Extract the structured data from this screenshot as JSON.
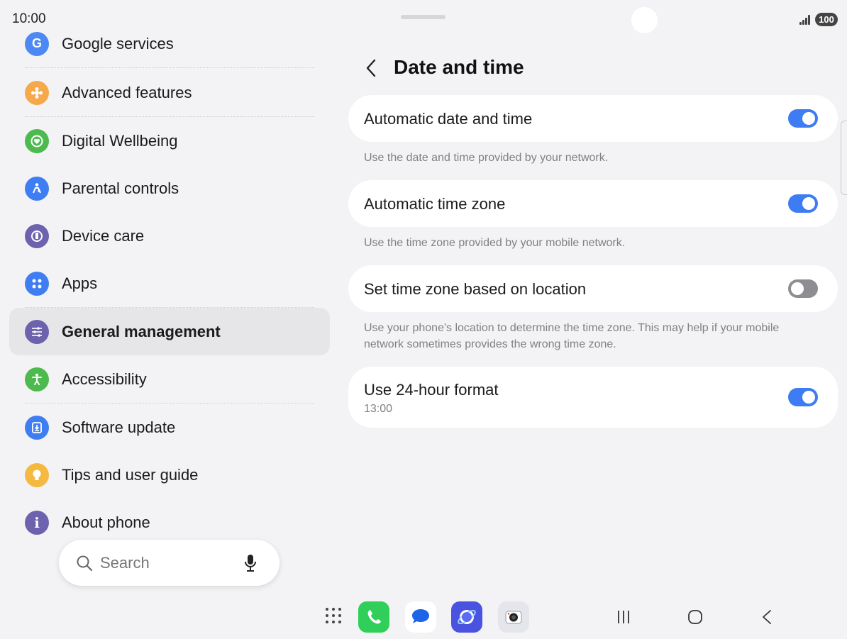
{
  "status_bar": {
    "time": "10:00",
    "battery": "100"
  },
  "sidebar": {
    "items": [
      {
        "label": "Google services"
      },
      {
        "label": "Advanced features"
      },
      {
        "label": "Digital Wellbeing"
      },
      {
        "label": "Parental controls"
      },
      {
        "label": "Device care"
      },
      {
        "label": "Apps"
      },
      {
        "label": "General management"
      },
      {
        "label": "Accessibility"
      },
      {
        "label": "Software update"
      },
      {
        "label": "Tips and user guide"
      },
      {
        "label": "About phone"
      }
    ],
    "selected": "General management"
  },
  "search": {
    "placeholder": "Search"
  },
  "page": {
    "title": "Date and time",
    "settings": [
      {
        "title": "Automatic date and time",
        "enabled": true,
        "description": "Use the date and time provided by your network."
      },
      {
        "title": "Automatic time zone",
        "enabled": true,
        "description": "Use the time zone provided by your mobile network."
      },
      {
        "title": "Set time zone based on location",
        "enabled": false,
        "description": "Use your phone's location to determine the time zone. This may help if your mobile network sometimes provides the wrong time zone."
      },
      {
        "title": "Use 24-hour format",
        "subtitle": "13:00",
        "enabled": true
      }
    ]
  },
  "colors": {
    "accent": "#3e7cf4",
    "background": "#f3f3f5",
    "toggle_off": "#8e8e92"
  }
}
